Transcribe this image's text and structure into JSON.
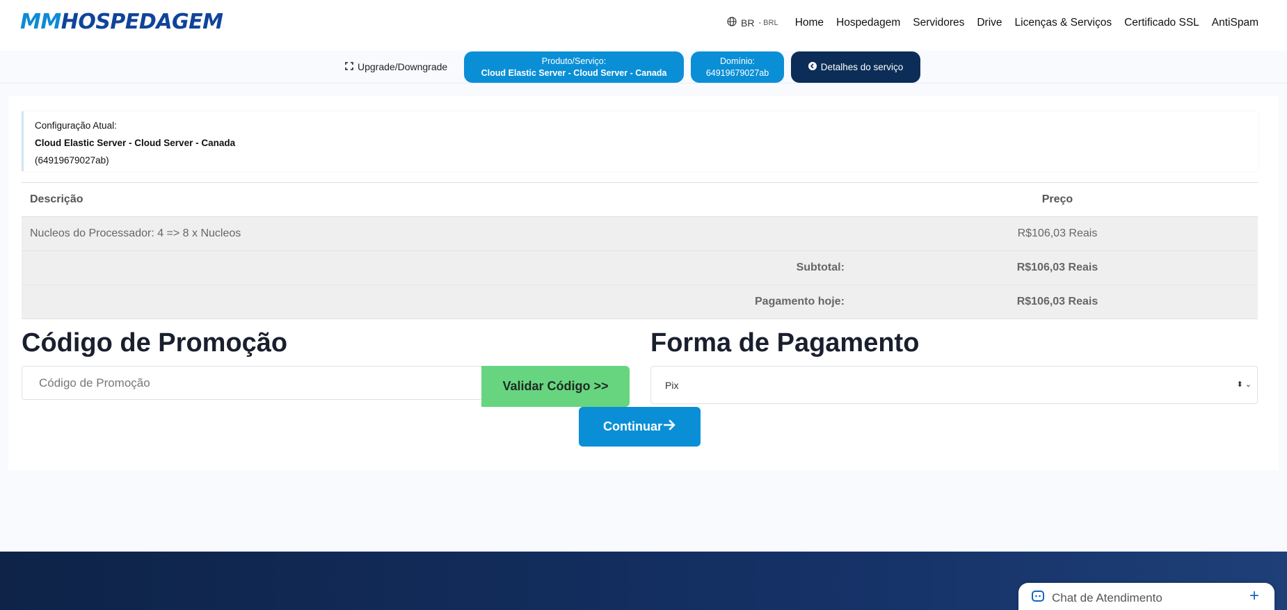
{
  "header": {
    "logo_mm": "MM",
    "logo_rest": "HOSPEDAGEM",
    "lang": "BR",
    "currency": "- BRL",
    "nav": [
      "Home",
      "Hospedagem",
      "Servidores",
      "Drive",
      "Licenças & Serviços",
      "Certificado SSL",
      "AntiSpam"
    ]
  },
  "subbar": {
    "upgrade_label": "Upgrade/Downgrade",
    "product_label": "Produto/Serviço:",
    "product_value": "Cloud Elastic Server - Cloud Server - Canada",
    "domain_label": "Domínio:",
    "domain_value": "64919679027ab",
    "details_label": "Detalhes do serviço"
  },
  "config": {
    "title": "Configuração Atual:",
    "product": "Cloud Elastic Server - Cloud Server - Canada",
    "id": "(64919679027ab)"
  },
  "summary": {
    "col_desc": "Descrição",
    "col_price": "Preço",
    "item_desc": "Nucleos do Processador: 4 => 8 x Nucleos",
    "item_price": "R$106,03 Reais",
    "subtotal_label": "Subtotal:",
    "subtotal_value": "R$106,03 Reais",
    "today_label": "Pagamento hoje:",
    "today_value": "R$106,03 Reais"
  },
  "promo": {
    "heading": "Código de Promoção",
    "placeholder": "Código de Promoção",
    "validate_label": "Validar Código >>"
  },
  "payment": {
    "heading": "Forma de Pagamento",
    "selected": "Pix"
  },
  "continue_label": "Continuar",
  "chat": {
    "label": "Chat de Atendimento"
  }
}
